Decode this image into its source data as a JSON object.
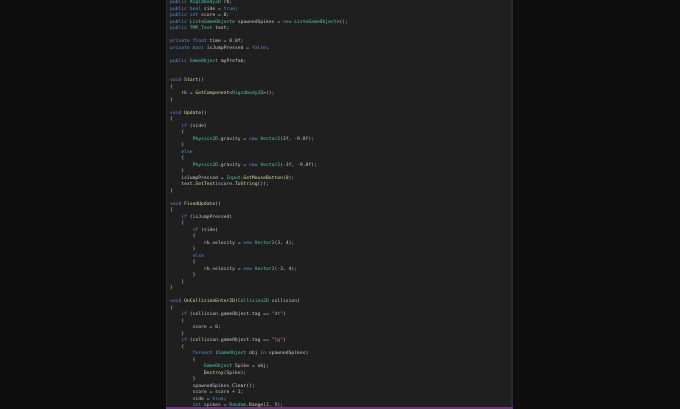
{
  "editor": {
    "lines": [
      "public Rigidbody2D rb;",
      "public bool side = true;",
      "public int score = 0;",
      "public List<GameObject> spawnedSpikes = new List<GameObject>();",
      "public TMP_Text text;",
      "",
      "private float time = 0.0f;",
      "private bool isJumpPressed = false;",
      "",
      "public GameObject myPrefab;",
      "",
      "",
      "void Start()",
      "{",
      "    rb = GetComponent<Rigidbody2D>();",
      "}",
      "",
      "void Update()",
      "{",
      "    if (side)",
      "    {",
      "        Physics2D.gravity = new Vector2(3f, -9.8f);",
      "    }",
      "    else",
      "    {",
      "        Physics2D.gravity = new Vector2(-3f, -9.8f);",
      "    }",
      "    isJumpPressed = Input.GetMouseButton(0);",
      "    text.SetText(score.ToString());",
      "}",
      "",
      "void FixedUpdate()",
      "{",
      "    if (isJumpPressed)",
      "    {",
      "        if (side)",
      "        {",
      "            rb.velocity = new Vector2(3, 4);",
      "        }",
      "        else",
      "        {",
      "            rb.velocity = new Vector2(-3, 4);",
      "        }",
      "    }",
      "}",
      "",
      "void OnCollisionEnter2D(Collision2D collision)",
      "{",
      "    if (collision.gameObject.tag == \"dt\")",
      "    {",
      "        score = 0;",
      "    }",
      "    if (collision.gameObject.tag == \"lg\")",
      "    {",
      "        foreach (GameObject obj in spawnedSpikes)",
      "        {",
      "            GameObject Spike = obj;",
      "            Destroy(Spike);",
      "        }",
      "        spawnedSpikes.Clear();",
      "        score = score + 1;",
      "        side = true;",
      "        int spikes = Random.Range(2, 5);"
    ]
  }
}
